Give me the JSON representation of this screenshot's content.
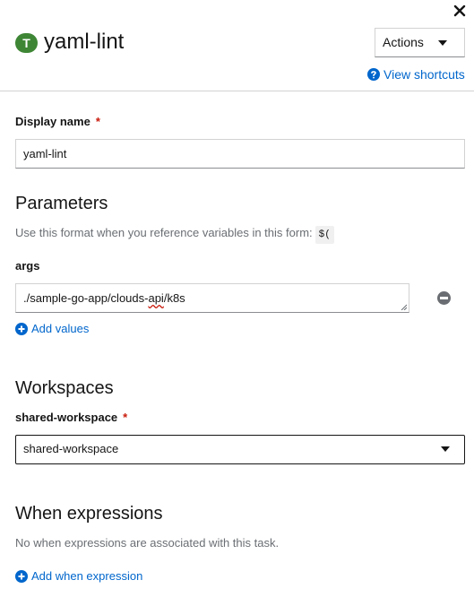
{
  "header": {
    "badge_letter": "T",
    "title": "yaml-lint",
    "actions_label": "Actions",
    "shortcuts_label": "View shortcuts"
  },
  "display_name": {
    "label": "Display name",
    "required_mark": "*",
    "value": "yaml-lint"
  },
  "parameters": {
    "title": "Parameters",
    "helper_text": "Use this format when you reference variables in this form:",
    "helper_code": "$(",
    "args_label": "args",
    "args_value_prefix": "./sample-go-app/clouds-",
    "args_value_misspelled": "api",
    "args_value_suffix": "/k8s",
    "add_values_label": "Add values"
  },
  "workspaces": {
    "title": "Workspaces",
    "label": "shared-workspace",
    "required_mark": "*",
    "selected": "shared-workspace"
  },
  "when_expressions": {
    "title": "When expressions",
    "empty_text": "No when expressions are associated with this task.",
    "add_label": "Add when expression"
  },
  "colors": {
    "link": "#0066cc",
    "required": "#c9190b",
    "badge": "#3e8635"
  },
  "icons": [
    "close-icon",
    "question-circle-icon",
    "plus-circle-icon",
    "minus-circle-icon",
    "caret-down-icon"
  ]
}
